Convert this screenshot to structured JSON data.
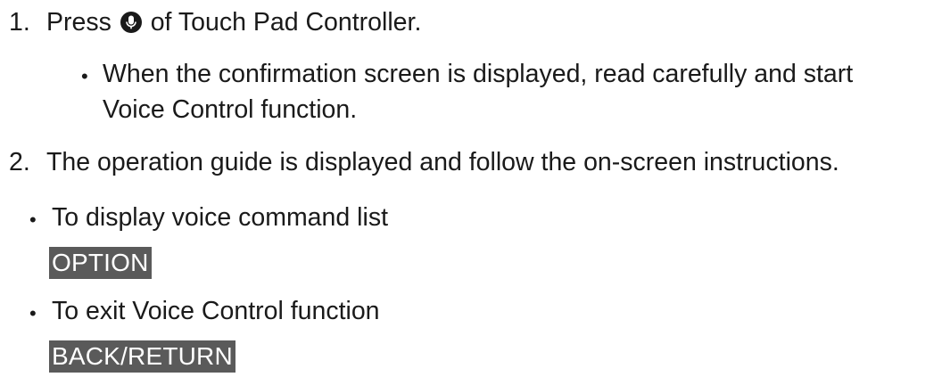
{
  "steps": [
    {
      "number": "1.",
      "text_before": "Press",
      "icon": "microphone-icon",
      "text_after": "of Touch Pad Controller."
    },
    {
      "number": "2.",
      "text": "The operation guide is displayed and follow the on-screen instructions."
    }
  ],
  "step1_note": {
    "line1": "When the confirmation screen is displayed, read carefully and start",
    "line2": "Voice Control function."
  },
  "tips": [
    {
      "text": "To display voice command list",
      "key": "OPTION"
    },
    {
      "text": "To exit Voice Control function",
      "key": "BACK/RETURN"
    }
  ],
  "colors": {
    "text": "#1a1a1a",
    "key_background": "#5a5a5a",
    "key_text": "#ffffff"
  }
}
